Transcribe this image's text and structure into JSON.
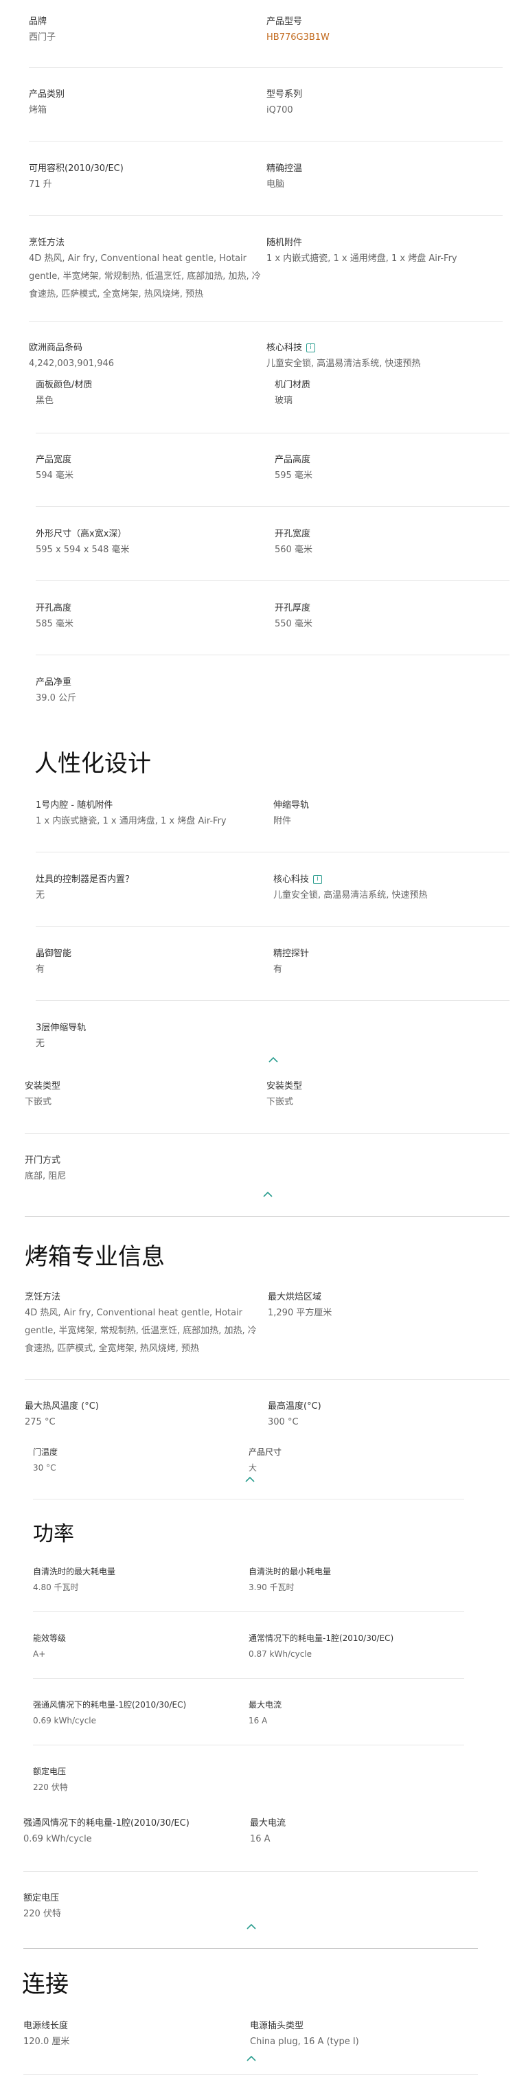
{
  "s1": [
    {
      "l": "品牌",
      "v": "西门子"
    },
    {
      "l": "产品型号",
      "v": "HB776G3B1W"
    },
    {
      "l": "产品类别",
      "v": "烤箱"
    },
    {
      "l": "型号系列",
      "v": "iQ700"
    },
    {
      "l": "可用容积(2010/30/EC)",
      "v": "71 升"
    },
    {
      "l": "精确控温",
      "v": "电脑"
    },
    {
      "l": "烹饪方法",
      "v": "4D 热风, Air fry, Conventional heat gentle, Hotair gentle, 半宽烤架, 常规制热, 低温烹饪, 底部加热, 加热, 冷食速热, 匹萨模式, 全宽烤架, 热风烧烤, 预热"
    },
    {
      "l": "随机附件",
      "v": "1 x 内嵌式搪瓷, 1 x 通用烤盘, 1 x 烤盘 Air-Fry"
    },
    {
      "l": "欧洲商品条码",
      "v": "4,242,003,901,946"
    },
    {
      "l": "核心科技",
      "v": "儿童安全锁, 高温易清洁系统, 快速预热"
    },
    {
      "l": "面板颜色/材质",
      "v": "黑色"
    },
    {
      "l": "机门材质",
      "v": "玻璃"
    },
    {
      "l": "产品宽度",
      "v": "594 毫米"
    },
    {
      "l": "产品高度",
      "v": "595 毫米"
    },
    {
      "l": "外形尺寸（高x宽x深）",
      "v": "595 x 594 x 548 毫米"
    },
    {
      "l": "开孔宽度",
      "v": "560 毫米"
    },
    {
      "l": "开孔高度",
      "v": "585 毫米"
    },
    {
      "l": "开孔厚度",
      "v": "550 毫米"
    },
    {
      "l": "产品净重",
      "v": "39.0 公斤"
    }
  ],
  "h_human": "人性化设计",
  "s2": [
    {
      "l": "1号内腔 - 随机附件",
      "v": "1 x 内嵌式搪瓷, 1 x 通用烤盘, 1 x 烤盘 Air-Fry"
    },
    {
      "l": "伸缩导轨",
      "v": "附件"
    },
    {
      "l": "灶具的控制器是否内置？",
      "v": "无"
    },
    {
      "l": "核心科技",
      "v": "儿童安全锁, 高温易清洁系统, 快速预热"
    },
    {
      "l": "晶御智能",
      "v": "有"
    },
    {
      "l": "精控探针",
      "v": "有"
    },
    {
      "l": "3层伸缩导轨",
      "v": "无"
    },
    {
      "l": "安装类型",
      "v": "下嵌式"
    },
    {
      "l": "安装类型",
      "v": "下嵌式"
    },
    {
      "l": "开门方式",
      "v": "底部, 阻尼"
    }
  ],
  "h_oven": "烤箱专业信息",
  "s3": [
    {
      "l": "烹饪方法",
      "v": "4D 热风, Air fry, Conventional heat gentle, Hotair gentle, 半宽烤架, 常规制热, 低温烹饪, 底部加热, 加热, 冷食速热, 匹萨模式, 全宽烤架, 热风烧烤, 预热"
    },
    {
      "l": "最大烘焙区域",
      "v": "1,290 平方厘米"
    },
    {
      "l": "最大热风温度 (°C)",
      "v": "275 °C"
    },
    {
      "l": "最高温度(°C)",
      "v": "300 °C"
    },
    {
      "l": "门温度",
      "v": "30 °C"
    },
    {
      "l": "产品尺寸",
      "v": "大"
    }
  ],
  "h_power": "功率",
  "s4": [
    {
      "l": "自清洗时的最大耗电量",
      "v": "4.80 千瓦时"
    },
    {
      "l": "自清洗时的最小耗电量",
      "v": "3.90 千瓦时"
    },
    {
      "l": "能效等级",
      "v": "A+"
    },
    {
      "l": "通常情况下的耗电量-1腔(2010/30/EC)",
      "v": "0.87 kWh/cycle"
    },
    {
      "l": "强通风情况下的耗电量-1腔(2010/30/EC)",
      "v": "0.69 kWh/cycle"
    },
    {
      "l": "最大电流",
      "v": "16 A"
    },
    {
      "l": "额定电压",
      "v": "220 伏特"
    }
  ],
  "s5": [
    {
      "l": "强通风情况下的耗电量-1腔(2010/30/EC)",
      "v": "0.69 kWh/cycle"
    },
    {
      "l": "最大电流",
      "v": "16 A"
    },
    {
      "l": "额定电压",
      "v": "220 伏特"
    }
  ],
  "h_conn": "连接",
  "s6": [
    {
      "l": "电源线长度",
      "v": "120.0 厘米"
    },
    {
      "l": "电源插头类型",
      "v": "China plug, 16 A (type I)"
    }
  ],
  "icons": {
    "info": "info-icon",
    "chevron": "chevron-up-icon"
  },
  "colors": {
    "accent": "#2a9d8f",
    "model": "#c26a1e"
  }
}
